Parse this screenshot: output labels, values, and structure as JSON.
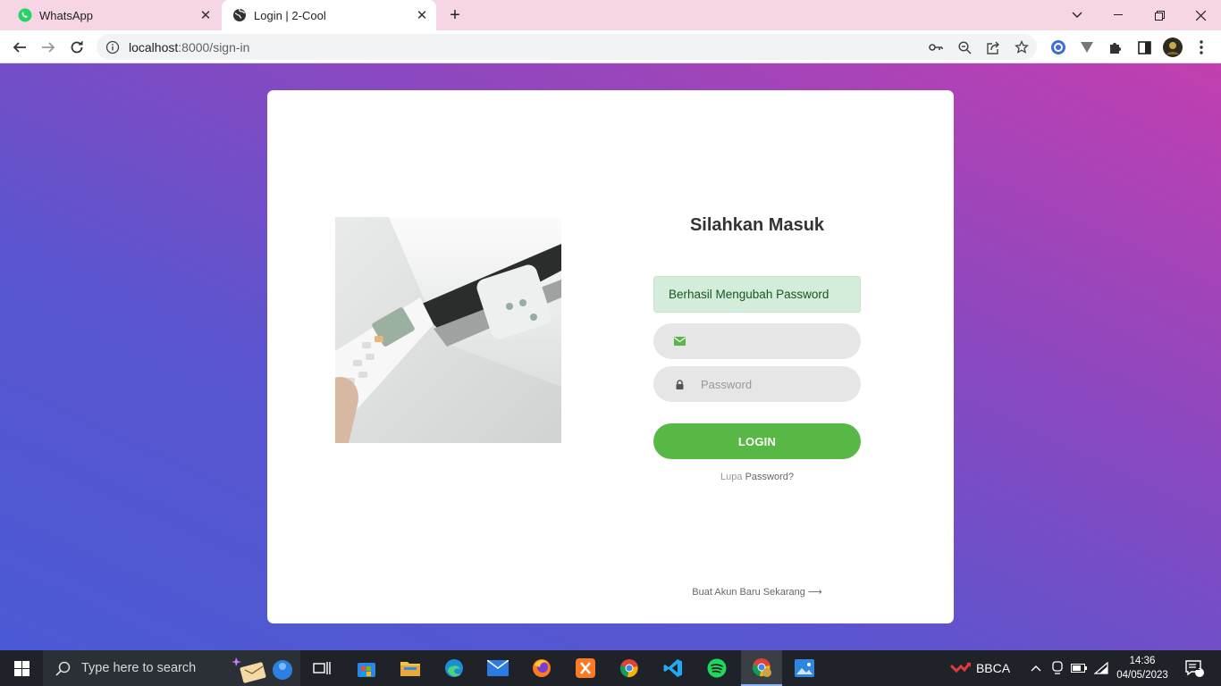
{
  "browser": {
    "tabs": [
      {
        "title": "WhatsApp",
        "active": false
      },
      {
        "title": "Login | 2-Cool",
        "active": true
      }
    ],
    "url_host": "localhost",
    "url_rest": ":8000/sign-in"
  },
  "login": {
    "heading": "Silahkan Masuk",
    "alert": "Berhasil Mengubah Password",
    "email_value": "",
    "password_placeholder": "Password",
    "login_button": "LOGIN",
    "forgot_prefix": "Lupa",
    "forgot_link": "Password?",
    "create_account": "Buat Akun Baru Sekarang",
    "arrow": "⟶"
  },
  "taskbar": {
    "search_placeholder": "Type here to search",
    "stock_label": "BBCA",
    "time": "14:36",
    "date": "04/05/2023",
    "notification_count": "1"
  },
  "colors": {
    "accent_green": "#57b846",
    "alert_bg": "#d4edda",
    "gradient_start": "#c23fb0",
    "gradient_end": "#4a5ad4"
  }
}
